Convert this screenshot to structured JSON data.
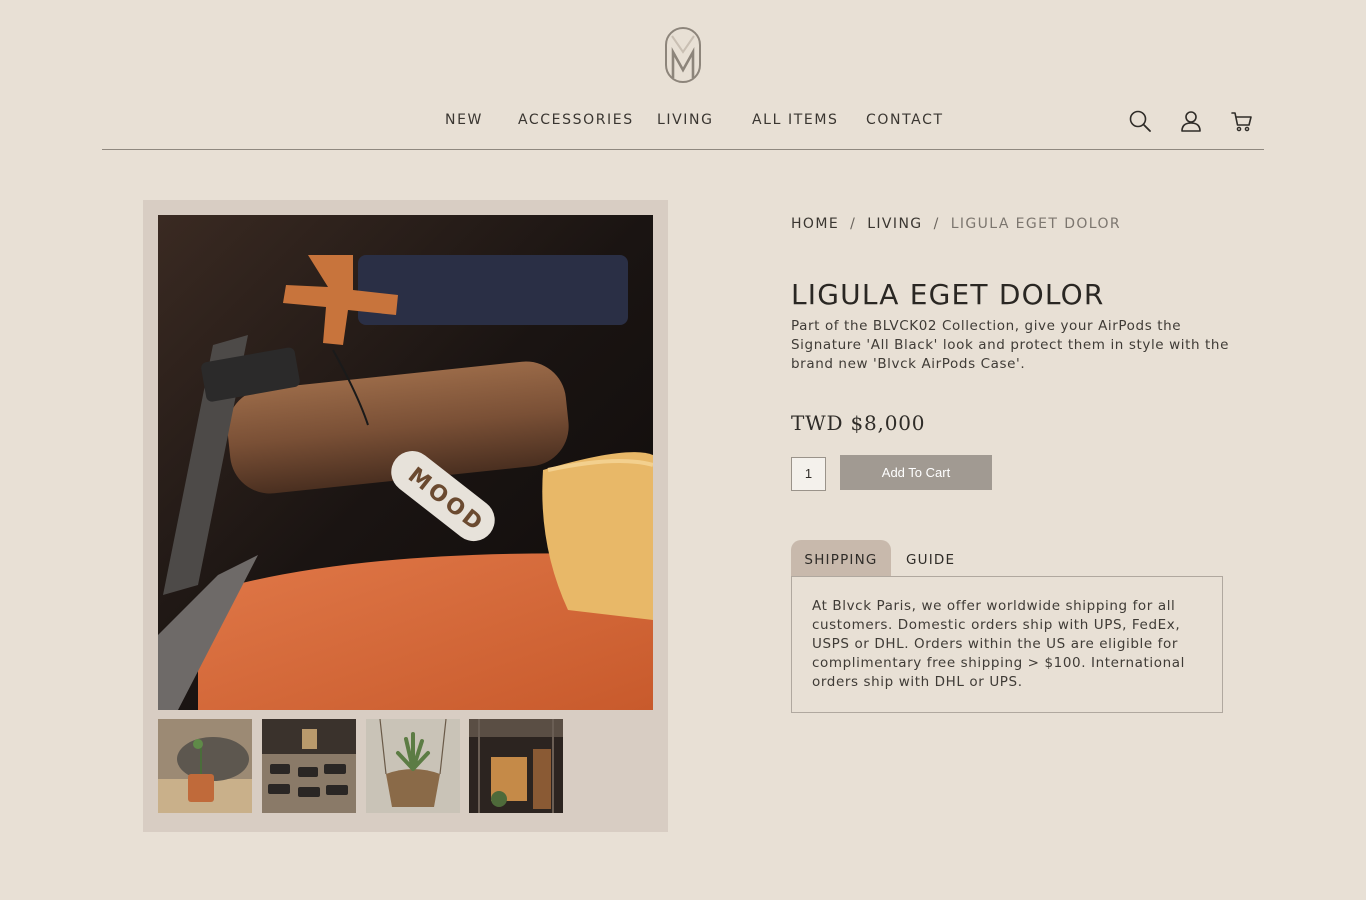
{
  "brand": {
    "logo": "M"
  },
  "nav": {
    "items": [
      "NEW",
      "ACCESSORIES",
      "LIVING",
      "ALL ITEMS",
      "CONTACT"
    ],
    "icons": [
      "search-icon",
      "user-icon",
      "cart-icon"
    ]
  },
  "breadcrumb": {
    "home": "HOME",
    "category": "LIVING",
    "current": "LIGULA EGET DOLOR",
    "separator": "/"
  },
  "product": {
    "title": "LIGULA EGET DOLOR",
    "description": "Part of the BLVCK02 Collection, give your AirPods the Signature 'All Black' look and protect them in style with the brand new 'Blvck AirPods Case'.",
    "price": "TWD $8,000",
    "quantity": "1",
    "add_to_cart_label": "Add To Cart",
    "image_tag_text": "MOOD"
  },
  "tabs": {
    "shipping_label": "SHIPPING",
    "guide_label": "GUIDE",
    "active": "SHIPPING",
    "shipping_text": "At Blvck Paris, we offer worldwide shipping for all customers. Domestic orders ship with UPS, FedEx, USPS or DHL. Orders within the US are eligible for complimentary free shipping > $100. International orders ship with DHL or UPS."
  },
  "colors": {
    "background": "#e8e0d5",
    "gallery_bg": "#d8cdc3",
    "button": "#a19a92",
    "active_tab": "#c8b9ac"
  }
}
